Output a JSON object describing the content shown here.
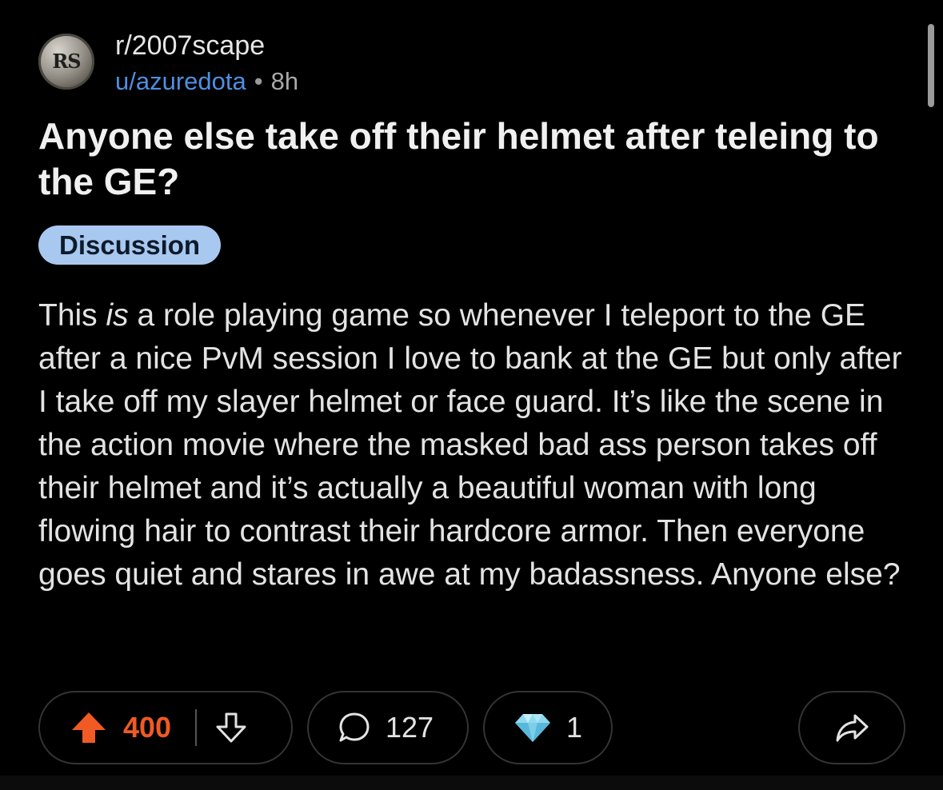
{
  "post": {
    "subreddit": "r/2007scape",
    "avatar_text": "RS",
    "username": "u/azuredota",
    "separator": "•",
    "time_ago": "8h",
    "title": "Anyone else take off their helmet after teleing to the GE?",
    "flair": "Discussion",
    "body": {
      "part1": "This ",
      "emphasis": "is",
      "part2": " a role playing game so whenever I teleport to the GE after a nice PvM session I love to bank at the GE but only after I take off my slayer helmet or face guard. It’s like the scene in the action movie where the masked bad ass person takes off their helmet and it’s actually a beautiful woman with long flowing hair to contrast their hardcore armor. Then everyone goes quiet and stares in awe at my badassness. Anyone else?"
    }
  },
  "actions": {
    "upvotes": "400",
    "comments": "127",
    "awards": "1"
  },
  "icons": {
    "upvote": "upvote-arrow-icon",
    "downvote": "downvote-arrow-icon",
    "comment": "comment-bubble-icon",
    "award": "diamond-award-icon",
    "share": "share-arrow-icon"
  },
  "colors": {
    "background": "#000000",
    "username": "#4f8fe0",
    "flair_bg": "#a8c8f0",
    "upvote": "#f05a24",
    "pill_border": "#343434"
  }
}
